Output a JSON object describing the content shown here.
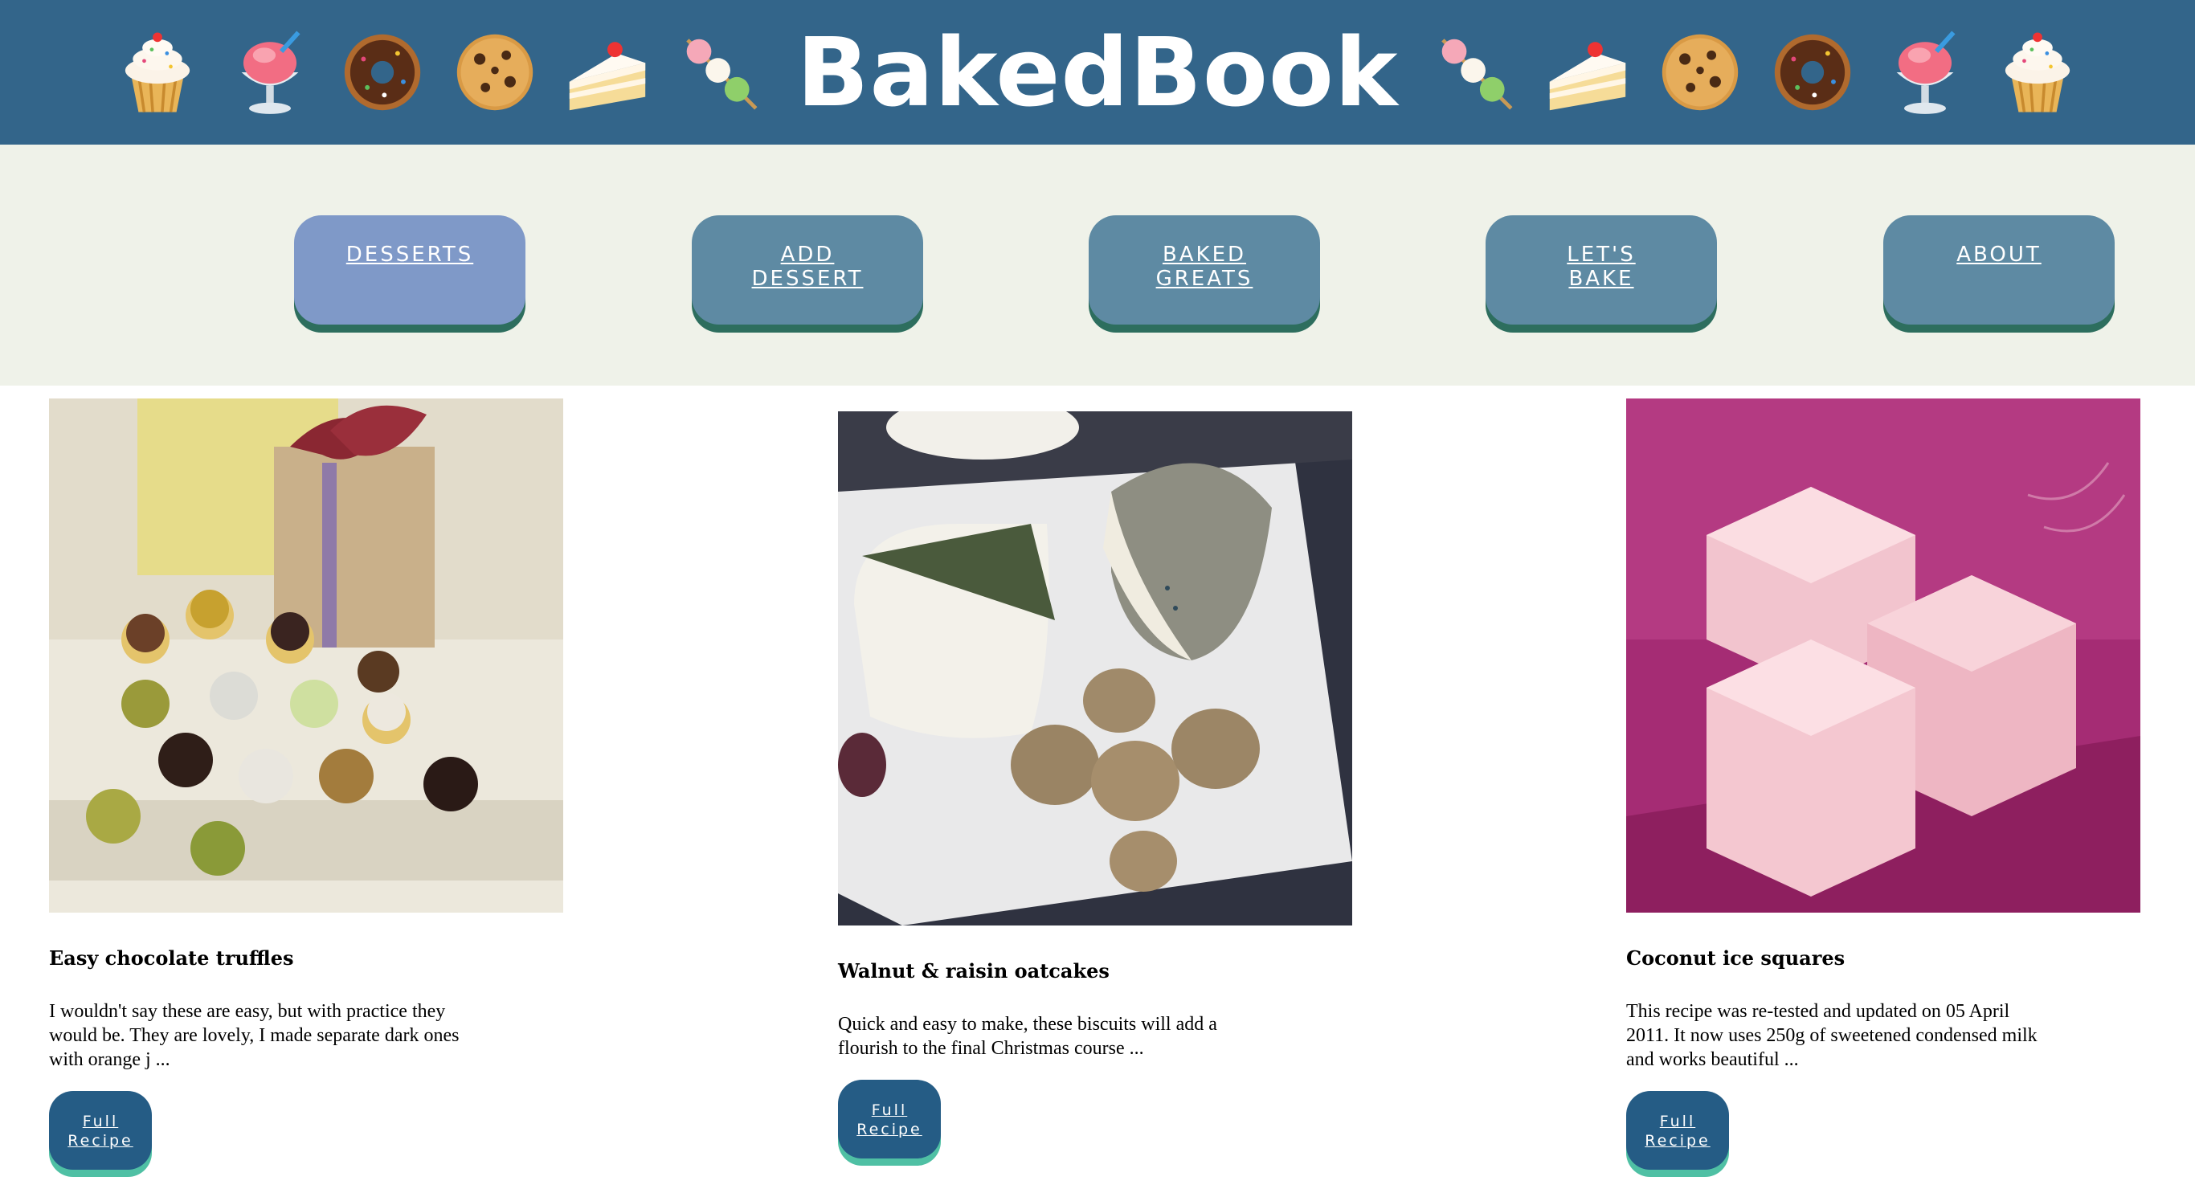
{
  "header": {
    "title": "BakedBook",
    "icons_left": [
      "cupcake-icon",
      "shaved-ice-icon",
      "doughnut-icon",
      "cookie-icon",
      "shortcake-icon",
      "dango-icon"
    ],
    "icons_right": [
      "dango-icon",
      "shortcake-icon",
      "cookie-icon",
      "doughnut-icon",
      "shaved-ice-icon",
      "cupcake-icon"
    ],
    "background_color": "#33658a"
  },
  "nav": {
    "items": [
      {
        "lines": [
          "Desserts"
        ],
        "active": true
      },
      {
        "lines": [
          "Add",
          "Dessert"
        ],
        "active": false
      },
      {
        "lines": [
          "Baked",
          "Greats"
        ],
        "active": false
      },
      {
        "lines": [
          "Let's",
          "Bake"
        ],
        "active": false
      },
      {
        "lines": [
          "About"
        ],
        "active": false
      }
    ],
    "background_color": "#eff2e9",
    "button_color": "#5e8aa3",
    "active_button_color": "#7f99c8"
  },
  "recipes": [
    {
      "title": "Easy chocolate truffles",
      "description": "I wouldn't say these are easy, but with practice they would be. They are lovely, I made separate dark ones with orange j ...",
      "button_lines": [
        "Full",
        "Recipe"
      ],
      "image": "chocolate-truffles-photo"
    },
    {
      "title": "Walnut & raisin oatcakes",
      "description": "Quick and easy to make, these biscuits will add a flourish to the final Christmas course ...",
      "button_lines": [
        "Full",
        "Recipe"
      ],
      "image": "oatcakes-cheese-photo"
    },
    {
      "title": "Coconut ice squares",
      "description": "This recipe was re-tested and updated on 05 April 2011. It now uses 250g of sweetened condensed milk and works beautiful ...",
      "button_lines": [
        "Full",
        "Recipe"
      ],
      "image": "coconut-ice-photo"
    }
  ]
}
